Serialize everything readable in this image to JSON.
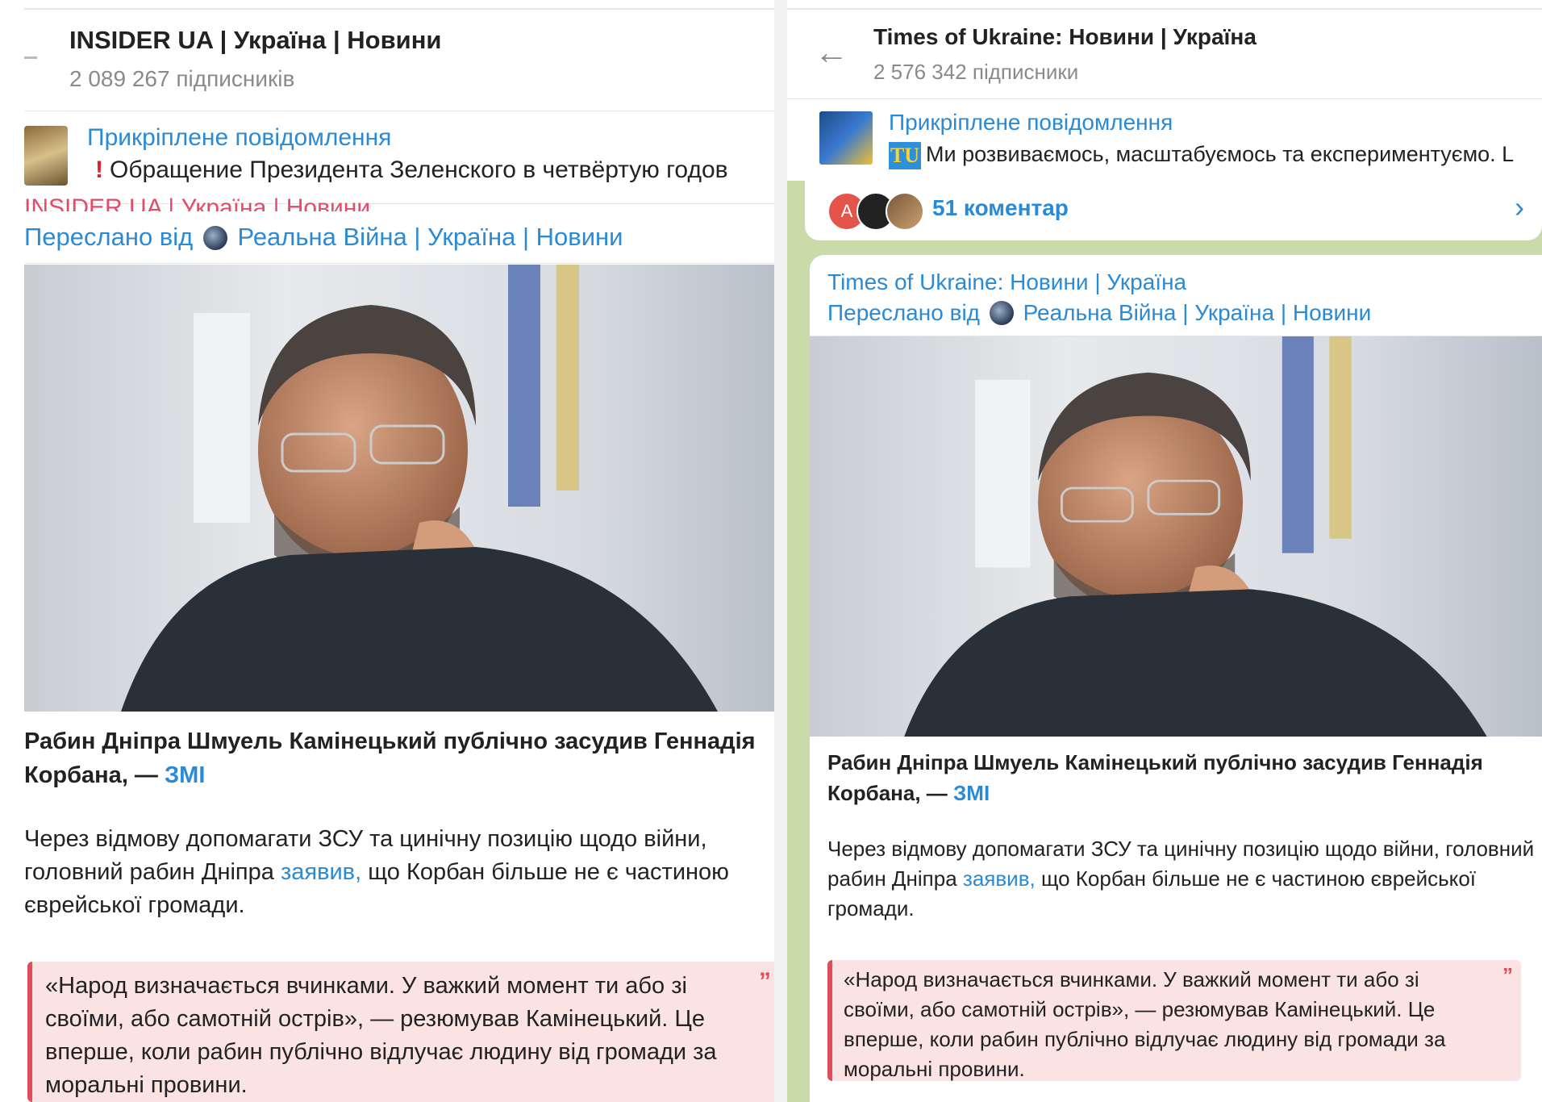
{
  "left": {
    "channel_title": "INSIDER UA | Україна | Новини",
    "subscribers": "2 089 267 підписників",
    "pinned_label": "Прикріплене повідомлення",
    "pinned_text": "Обращение Президента Зеленского в четвёртую годов",
    "channel_peek": "INSIDER UA | Україна | Новини",
    "forwarded_prefix": "Переслано від",
    "forwarded_source": "Реальна Війна | Україна | Новини",
    "headline": "Рабин Дніпра Шмуель Камінецький публічно засудив Геннадія Корбана, —",
    "headline_link": "ЗМІ",
    "body_before": "Через відмову допомагати ЗСУ та цинічну позицію щодо війни, головний рабин Дніпра",
    "body_link": "заявив,",
    "body_after": "що Корбан більше не є частиною єврейської громади.",
    "quote": "«Народ визначається вчинками. У важкий момент ти або зі своїми, або самотній острів», — резюмував Камінецький. Це вперше, коли рабин публічно відлучає людину від громади за моральні провини."
  },
  "right": {
    "channel_title": "Times of Ukraine: Новини | Україна",
    "subscribers": "2 576 342 підписники",
    "pinned_label": "Прикріплене повідомлення",
    "pinned_badge": "TU",
    "pinned_text": "Ми розвиваємось, масштабуємось та експериментуємо. L",
    "comments_count": "51 коментар",
    "comment_avatar_letter": "A",
    "bubble_channel": "Times of Ukraine: Новини | Україна",
    "forwarded_prefix": "Переслано від",
    "forwarded_source": "Реальна Війна | Україна | Новини",
    "headline": "Рабин Дніпра Шмуель Камінецький публічно засудив Геннадія Корбана, —",
    "headline_link": "ЗМІ",
    "body_before": "Через відмову допомагати ЗСУ та цинічну позицію щодо війни, головний рабин Дніпра",
    "body_link": "заявив,",
    "body_after": "що Корбан більше не є частиною єврейської громади.",
    "quote": "«Народ визначається вчинками. У важкий момент ти або зі своїми, або самотній острів», — резюмував Камінецький. Це вперше, коли рабин публічно відлучає людину від громади за моральні провини."
  },
  "icons": {
    "back": "arrow-left-icon",
    "chevron": "chevron-right-icon",
    "exclamation": "exclamation-icon",
    "quote": "quote-icon"
  },
  "colors": {
    "link": "#2b8ad6",
    "quote_bg": "#fbe3e3",
    "quote_border": "#e24c5a",
    "chat_bg": "#c9dba8"
  }
}
